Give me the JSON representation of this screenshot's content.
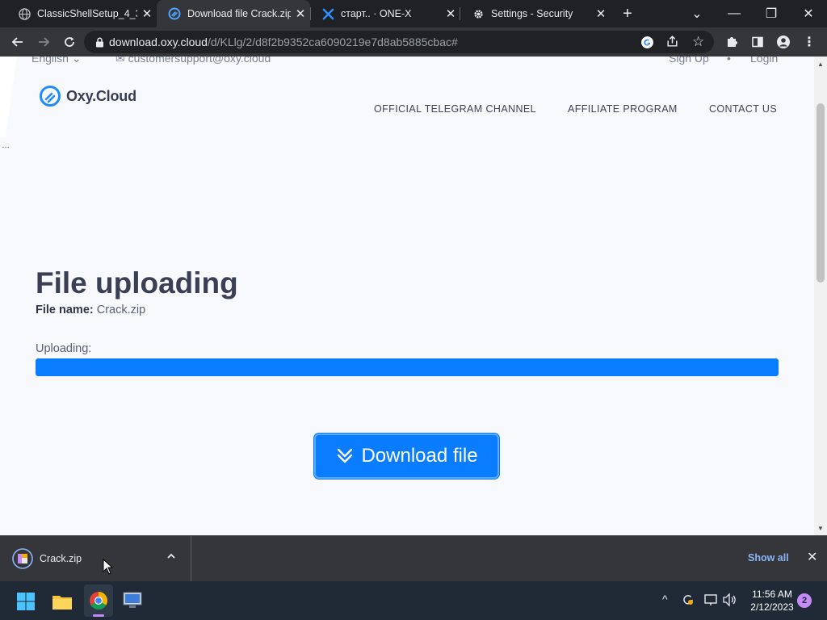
{
  "browser": {
    "tabs": [
      {
        "title": "ClassicShellSetup_4_3_",
        "icon": "globe-icon",
        "active": false
      },
      {
        "title": "Download file Crack.zip",
        "icon": "oxycloud-icon",
        "active": true
      },
      {
        "title": "старт.. · ONE-X",
        "icon": "onex-icon",
        "active": false
      },
      {
        "title": "Settings - Security",
        "icon": "gear-icon",
        "active": false
      }
    ],
    "url_host": "download.oxy.cloud",
    "url_path": "/d/KLlg/2/d8f2b9352ca6090219e7d8ab5885cbac#"
  },
  "page": {
    "top_language": "English",
    "top_email": "customersupport@oxy.cloud",
    "top_signup": "Sign Up",
    "top_login": "Login",
    "logo": "Oxy.Cloud",
    "nav": {
      "telegram": "OFFICIAL TELEGRAM CHANNEL",
      "affiliate": "AFFILIATE PROGRAM",
      "contact": "CONTACT US"
    },
    "title": "File uploading",
    "file_name_label": "File name:",
    "file_name": "Crack.zip",
    "uploading_label": "Uploading:",
    "upload_progress": 1.0,
    "download_button": "Download file",
    "accent_color": "#0a7cff"
  },
  "download_shelf": {
    "file": "Crack.zip",
    "show_all": "Show all"
  },
  "taskbar": {
    "time": "11:56 AM",
    "date": "2/12/2023",
    "notifications": "2"
  }
}
